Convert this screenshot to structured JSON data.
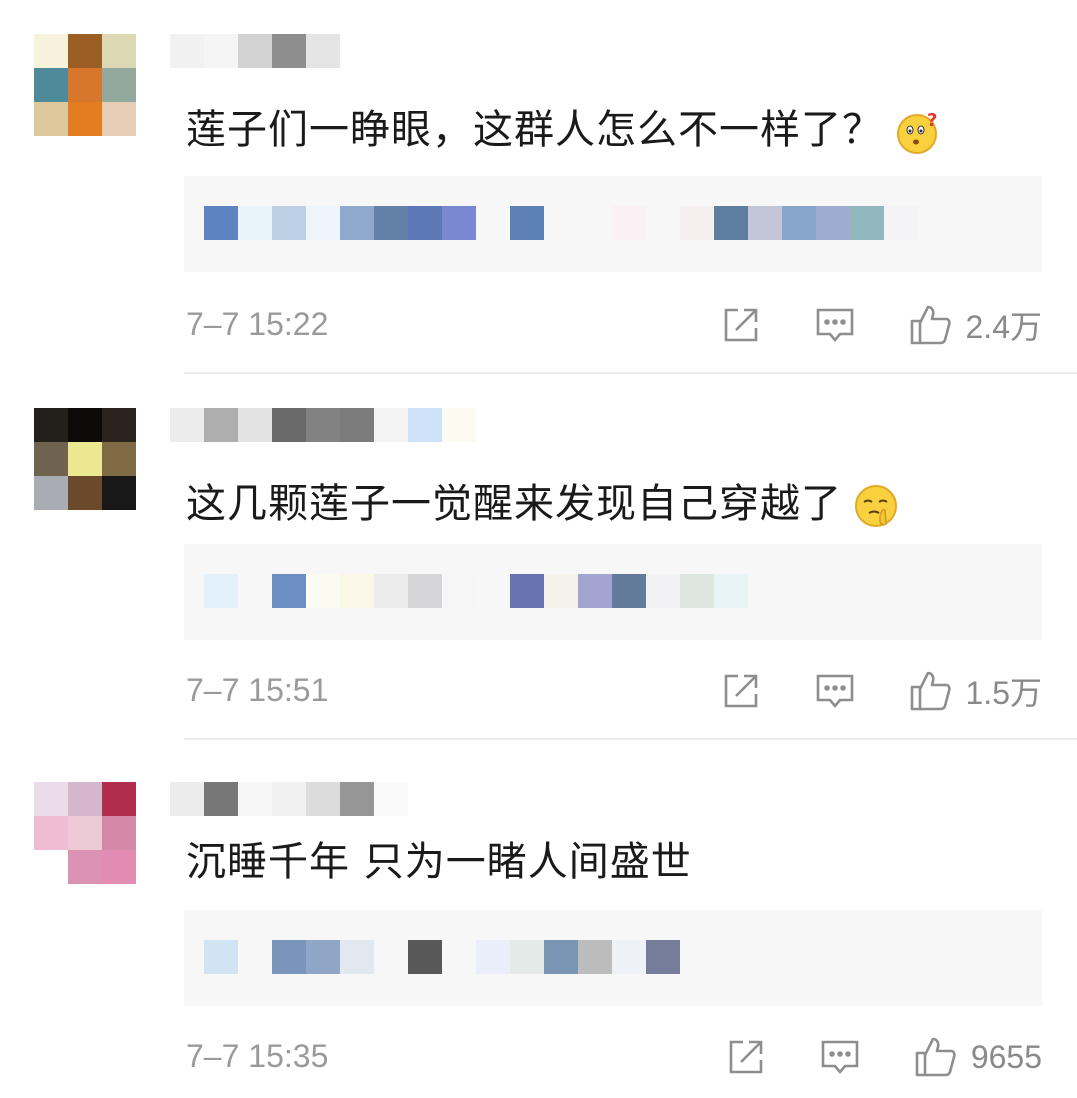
{
  "comments": [
    {
      "text": "莲子们一睁眼，这群人怎么不一样了？",
      "emoji": "confused-face-emoji",
      "time": "7–7 15:22",
      "likes": "2.4万"
    },
    {
      "text": "这几颗莲子一觉醒来发现自己穿越了",
      "emoji": "shush-face-emoji",
      "time": "7–7 15:51",
      "likes": "1.5万"
    },
    {
      "text": "沉睡千年 只为一睹人间盛世",
      "emoji": "",
      "time": "7–7 15:35",
      "likes": "9655"
    }
  ],
  "icons": {
    "repost": "repost-icon",
    "reply": "comment-icon",
    "like": "thumbs-up-icon"
  },
  "colors": {
    "text": "#1a1a1a",
    "meta": "#9a9a9a",
    "reply_bg": "#f7f7f7"
  }
}
